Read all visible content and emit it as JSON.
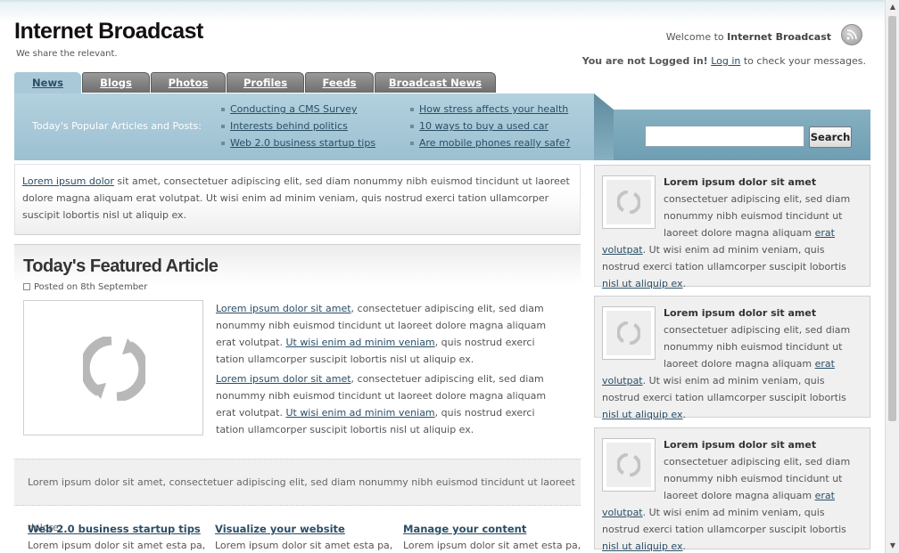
{
  "header": {
    "site_title": "Internet Broadcast",
    "tagline": "We share the relevant.",
    "welcome_prefix": "Welcome to ",
    "welcome_name": "Internet Broadcast",
    "rss_icon": "rss-feed-icon",
    "login_status": "You are not Logged in!",
    "login_link": "Log in",
    "login_suffix": " to check your messages."
  },
  "tabs": [
    "News",
    "Blogs",
    "Photos",
    "Profiles",
    "Feeds",
    "Broadcast News"
  ],
  "popular": {
    "label": "Today's Popular Articles and Posts:",
    "left_links": [
      "Conducting a CMS Survey",
      "Interests behind politics",
      "Web 2.0 business startup tips"
    ],
    "right_links": [
      "How stress affects your health",
      "10 ways to buy a used car",
      "Are mobile phones really safe?"
    ]
  },
  "search": {
    "placeholder": "",
    "button_label": "Search"
  },
  "intro": {
    "link": "Lorem ipsum dolor",
    "text": " sit amet, consectetuer adipiscing elit, sed diam nonummy nibh euismod tincidunt ut laoreet dolore magna aliquam erat volutpat. Ut wisi enim ad minim veniam, quis nostrud exerci tation ullamcorper suscipit lobortis nisl ut aliquip ex."
  },
  "featured": {
    "title": "Today's Featured Article",
    "posted": "Posted on 8th September",
    "image_icon": "loading-refresh-icon",
    "paragraphs": [
      {
        "link1": "Lorem ipsum dolor sit amet",
        "text1": ", consectetuer adipiscing elit, sed diam nonummy nibh euismod tincidunt ut laoreet dolore magna aliquam erat volutpat. ",
        "link2": "Ut wisi enim ad minim veniam",
        "text2": ", quis nostrud exerci tation ullamcorper suscipit lobortis nisl ut aliquip ex."
      },
      {
        "link1": "Lorem ipsum dolor sit amet",
        "text1": ", consectetuer adipiscing elit, sed diam nonummy nibh euismod tincidunt ut laoreet dolore magna aliquam erat volutpat. ",
        "link2": "Ut wisi enim ad minim veniam",
        "text2": ", quis nostrud exerci tation ullamcorper suscipit lobortis nisl ut aliquip ex."
      }
    ]
  },
  "strip_text": "Lorem ipsum dolor sit amet, consectetuer adipiscing elit, sed diam nonummy nibh euismod tincidunt ut laoreet dolore.",
  "columns": [
    {
      "title": "Web 2.0 business startup tips",
      "text": "Lorem ipsum dolor sit amet esta pa,"
    },
    {
      "title": "Visualize your website",
      "text": "Lorem ipsum dolor sit amet esta pa,"
    },
    {
      "title": "Manage your content",
      "text": "Lorem ipsum dolor sit amet esta pa,"
    }
  ],
  "sidebar_cards": [
    {
      "title": "Lorem ipsum dolor sit amet",
      "text1": "consectetuer adipiscing elit, sed diam nonummy nibh euismod tincidunt ut laoreet dolore magna aliquam ",
      "link1": "erat volutpat",
      "text2": ". Ut wisi enim ad minim veniam, quis nostrud exerci tation ullamcorper suscipit lobortis ",
      "link2": "nisl ut aliquip ex",
      "text3": "."
    },
    {
      "title": "Lorem ipsum dolor sit amet",
      "text1": "consectetuer adipiscing elit, sed diam nonummy nibh euismod tincidunt ut laoreet dolore magna aliquam ",
      "link1": "erat volutpat",
      "text2": ". Ut wisi enim ad minim veniam, quis nostrud exerci tation ullamcorper suscipit lobortis ",
      "link2": "nisl ut aliquip ex",
      "text3": "."
    },
    {
      "title": "Lorem ipsum dolor sit amet",
      "text1": "consectetuer adipiscing elit, sed diam nonummy nibh euismod tincidunt ut laoreet dolore magna aliquam ",
      "link1": "erat volutpat",
      "text2": ". Ut wisi enim ad minim veniam, quis nostrud exerci tation ullamcorper suscipit lobortis ",
      "link2": "nisl ut aliquip ex",
      "text3": "."
    }
  ],
  "colors": {
    "accent_blue": "#aac9d8",
    "band_dark": "#6f9eb2",
    "link": "#2a4e66",
    "tab_gray": "#808080"
  }
}
